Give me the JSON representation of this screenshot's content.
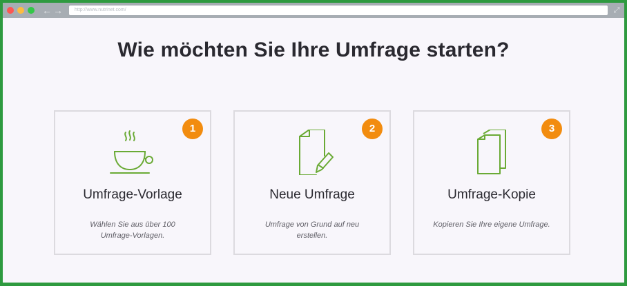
{
  "browser": {
    "url": "http://www.nutrinet.com/"
  },
  "page": {
    "title": "Wie möchten Sie Ihre Umfrage starten?"
  },
  "cards": [
    {
      "badge": "1",
      "title": "Umfrage-Vorlage",
      "description_lines": [
        "Wählen Sie aus über 100",
        "Umfrage-Vorlagen."
      ],
      "icon": "teacup-icon"
    },
    {
      "badge": "2",
      "title": "Neue Umfrage",
      "description_lines": [
        "Umfrage von Grund auf neu",
        "erstellen."
      ],
      "icon": "document-pencil-icon"
    },
    {
      "badge": "3",
      "title": "Umfrage-Kopie",
      "description_lines": [
        "Kopieren Sie Ihre eigene Umfrage."
      ],
      "icon": "copy-documents-icon"
    }
  ],
  "colors": {
    "accent_green": "#6aaa35",
    "badge_orange": "#f28c0f",
    "frame_green": "#2e9a3f"
  }
}
